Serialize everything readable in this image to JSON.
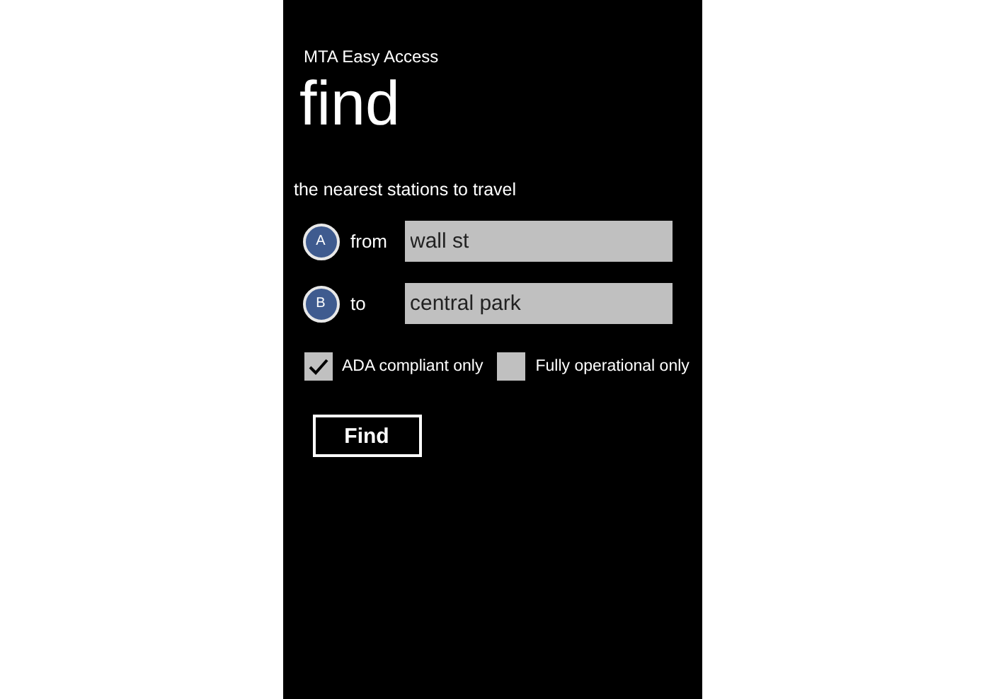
{
  "app_title": "MTA Easy Access",
  "page_title": "find",
  "subtitle": "the nearest stations to travel",
  "route": [
    {
      "marker": "A",
      "label": "from",
      "value": "wall st"
    },
    {
      "marker": "B",
      "label": "to",
      "value": "central park"
    }
  ],
  "options": [
    {
      "label": "ADA compliant only",
      "checked": true
    },
    {
      "label": "Fully operational only",
      "checked": false
    }
  ],
  "button": "Find"
}
